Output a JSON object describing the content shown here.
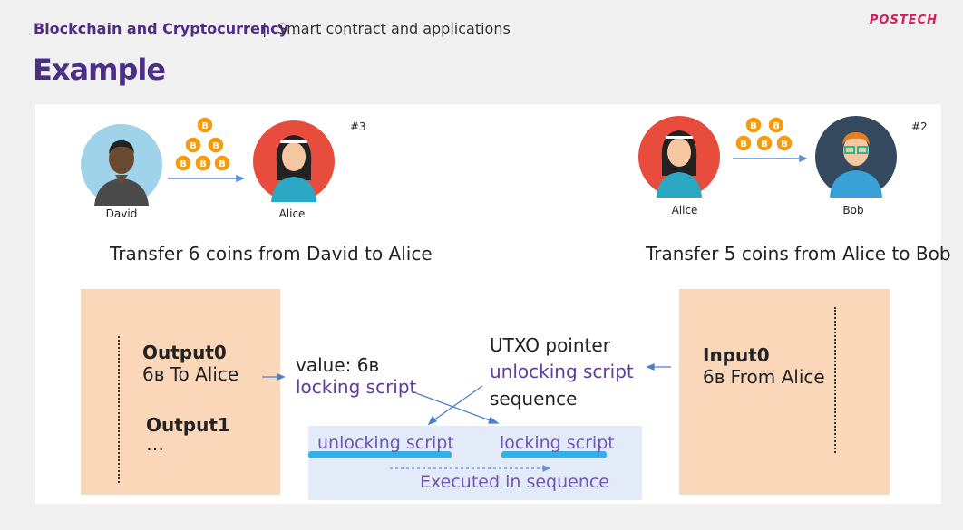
{
  "header": {
    "course": "Blockchain and Cryptocurrency",
    "separator": "|",
    "topic": "Smart contract and applications",
    "logo": "POSTECH"
  },
  "slide": {
    "title": "Example",
    "left": {
      "sender": "David",
      "receiver": "Alice",
      "number": "#3",
      "coin_count": 6,
      "caption": "Transfer 6 coins from David to Alice"
    },
    "right": {
      "sender": "Alice",
      "receiver": "Bob",
      "number": "#2",
      "coin_count": 5,
      "caption": "Transfer 5 coins from Alice to Bob"
    },
    "output_box": {
      "output0": "Output0",
      "output0_desc": "6ʙ To Alice",
      "output1": "Output1",
      "ellipsis": "…"
    },
    "middle": {
      "value": "value: 6ʙ",
      "locking": "locking script"
    },
    "input_fields": {
      "utxo": "UTXO pointer",
      "unlocking": "unlocking script",
      "sequence": "sequence"
    },
    "input_box": {
      "input0": "Input0",
      "input0_desc": "6ʙ From Alice"
    },
    "execution": {
      "unlocking": "unlocking script",
      "locking": "locking script",
      "caption": "Executed in sequence"
    }
  },
  "colors": {
    "title": "#4a2f86",
    "logo": "#d6195c",
    "box": "#fbd7b9",
    "highlight": "#37aee8",
    "exec_bg": "#e3eaf8",
    "coin": "#f39c12"
  },
  "icons": [
    "bitcoin-coin-icon",
    "arrow-right-icon",
    "arrow-left-icon",
    "person-avatar"
  ]
}
